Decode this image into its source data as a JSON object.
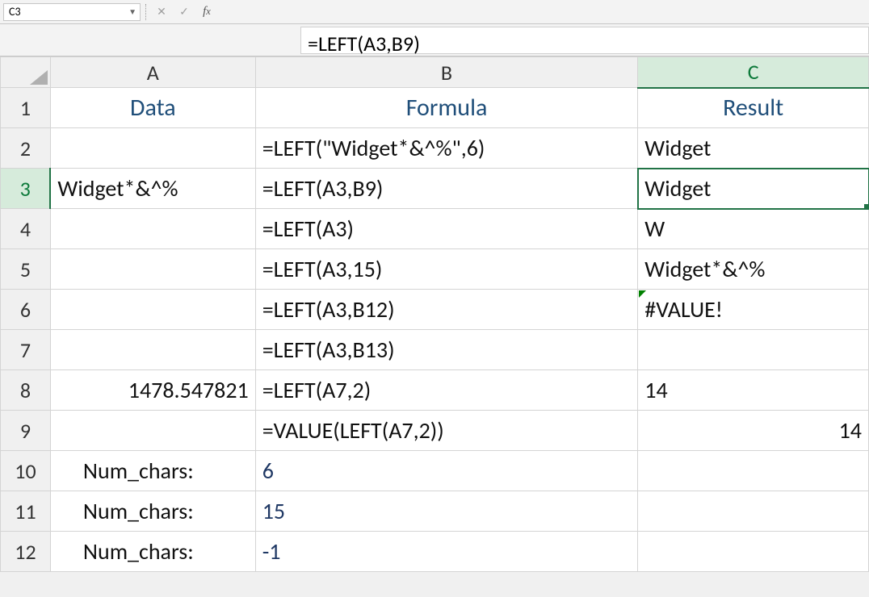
{
  "namebox": {
    "value": "C3"
  },
  "formula_bar": {
    "value": "=LEFT(A3,B9)"
  },
  "columns": [
    "A",
    "B",
    "C"
  ],
  "rows": [
    "1",
    "2",
    "3",
    "4",
    "5",
    "6",
    "7",
    "8",
    "9",
    "10",
    "11",
    "12"
  ],
  "selected": {
    "col": "C",
    "row": "3"
  },
  "cells": {
    "A1": "Data",
    "B1": "Formula",
    "C1": "Result",
    "A2": "",
    "B2": "=LEFT(\"Widget*&^%\",6)",
    "C2": "Widget",
    "A3": "Widget*&^%",
    "B3": "=LEFT(A3,B9)",
    "C3": "Widget",
    "B4": "=LEFT(A3)",
    "C4": "W",
    "B5": "=LEFT(A3,15)",
    "C5": "Widget*&^%",
    "B6": "=LEFT(A3,B12)",
    "C6": "#VALUE!",
    "B7": "=LEFT(A3,B13)",
    "C7": "",
    "A8": "1478.547821",
    "B8": "=LEFT(A7,2)",
    "C8": "14",
    "B9": "=VALUE(LEFT(A7,2))",
    "C9": "14",
    "A10": "Num_chars:",
    "B10": "6",
    "A11": "Num_chars:",
    "B11": "15",
    "A12": "Num_chars:",
    "B12": "-1"
  },
  "chart_data": {
    "type": "table",
    "title": "Excel LEFT function examples",
    "columns": [
      "Data",
      "Formula",
      "Result"
    ],
    "rows": [
      [
        "",
        "=LEFT(\"Widget*&^%\",6)",
        "Widget"
      ],
      [
        "Widget*&^%",
        "=LEFT(A3,B9)",
        "Widget"
      ],
      [
        "",
        "=LEFT(A3)",
        "W"
      ],
      [
        "",
        "=LEFT(A3,15)",
        "Widget*&^%"
      ],
      [
        "",
        "=LEFT(A3,B12)",
        "#VALUE!"
      ],
      [
        "",
        "=LEFT(A3,B13)",
        ""
      ],
      [
        "1478.547821",
        "=LEFT(A7,2)",
        "14"
      ],
      [
        "",
        "=VALUE(LEFT(A7,2))",
        "14"
      ],
      [
        "Num_chars:",
        "6",
        ""
      ],
      [
        "Num_chars:",
        "15",
        ""
      ],
      [
        "Num_chars:",
        "-1",
        ""
      ]
    ]
  }
}
